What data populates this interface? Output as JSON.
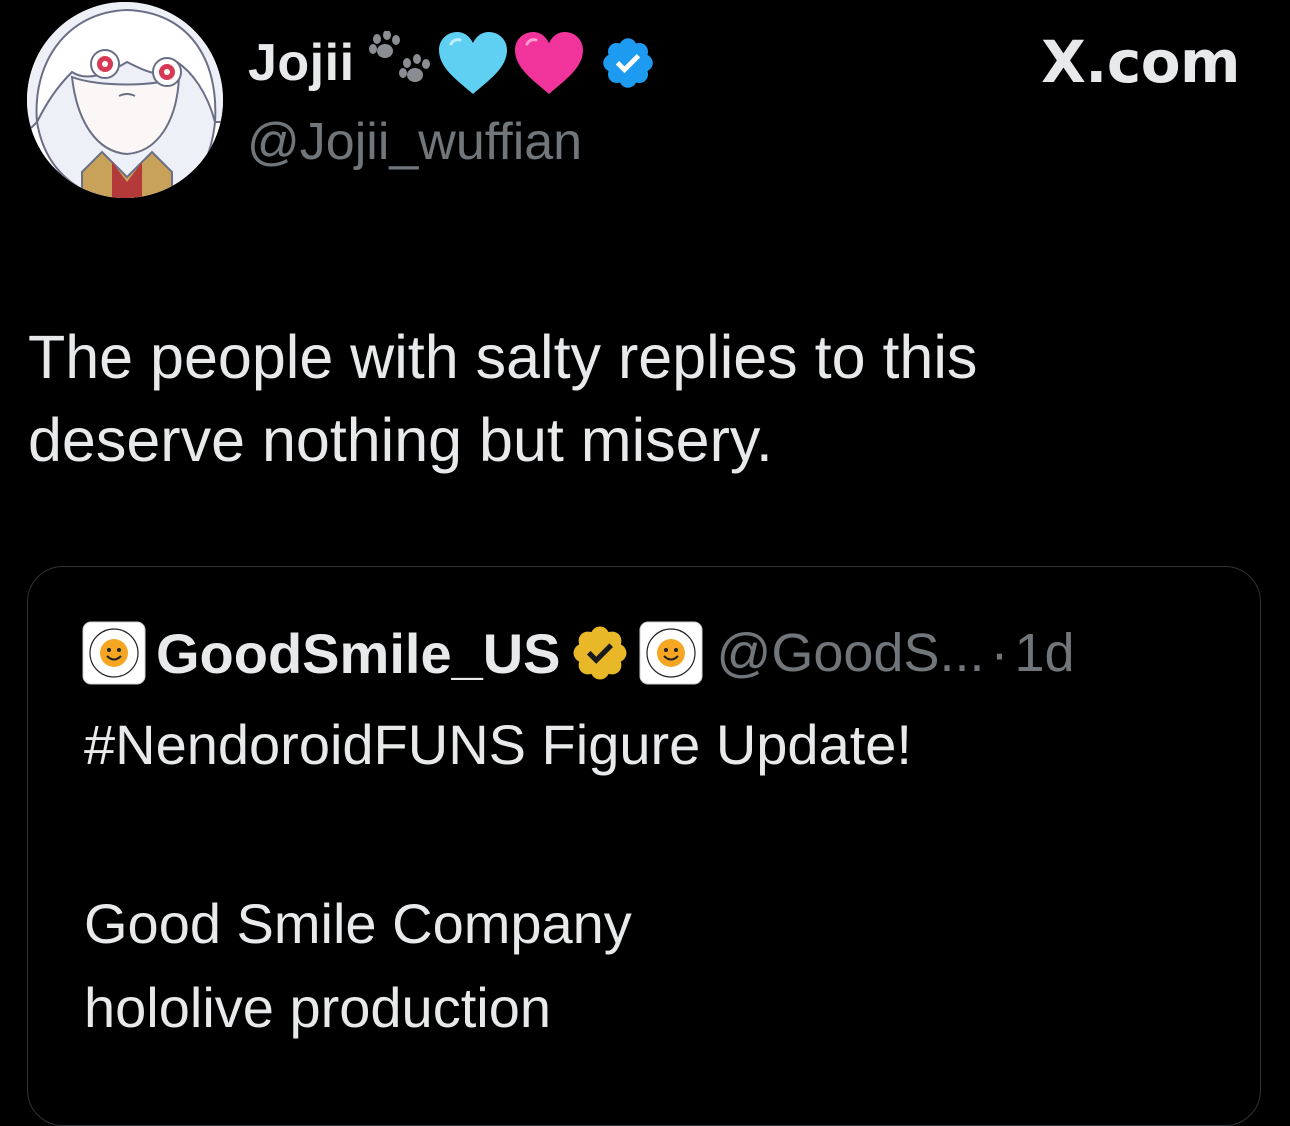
{
  "brand": "X.com",
  "author": {
    "display_name": "Jojii",
    "handle": "@Jojii_wuffian",
    "emojis": [
      "paw-prints-icon",
      "light-blue-heart-icon",
      "pink-heart-icon"
    ],
    "verified": true
  },
  "tweet": {
    "text_line1": "The people with salty replies to this",
    "text_line2": "deserve nothing but misery."
  },
  "quoted_tweet": {
    "display_name": "GoodSmile_US",
    "handle": "@GoodS...",
    "separator": "·",
    "time": "1d",
    "line1": "#NendoroidFUNS Figure Update!",
    "line2": "Good Smile Company",
    "line3": "hololive production"
  },
  "colors": {
    "background": "#000000",
    "text_primary": "#e7e9ea",
    "text_secondary": "#71767b",
    "verified_blue": "#1d9bf0",
    "verified_gold": "#e8b829",
    "border": "#2f3336"
  }
}
